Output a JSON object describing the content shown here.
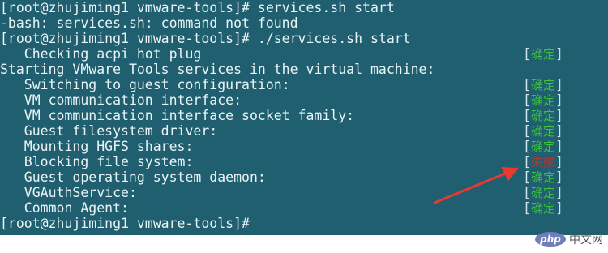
{
  "terminal": {
    "lines": [
      "[root@zhujiming1 vmware-tools]# services.sh start",
      "-bash: services.sh: command not found",
      "[root@zhujiming1 vmware-tools]# ./services.sh start",
      "   Checking acpi hot plug",
      "Starting VMware Tools services in the virtual machine:",
      "   Switching to guest configuration:",
      "   VM communication interface:",
      "   VM communication interface socket family:",
      "   Guest filesystem driver:",
      "   Mounting HGFS shares:",
      "   Blocking file system:",
      "   Guest operating system daemon:",
      "   VGAuthService:",
      "   Common Agent:",
      "[root@zhujiming1 vmware-tools]# "
    ],
    "statuses": {
      "acpi": "确定",
      "switching": "确定",
      "vmci": "确定",
      "vsock": "确定",
      "fs_driver": "确定",
      "hgfs": "确定",
      "blocking": "失败",
      "daemon": "确定",
      "vgauth": "确定",
      "agent": "确定"
    },
    "bracket_open": "[",
    "bracket_close": "]"
  },
  "watermark": {
    "logo": "php",
    "text": "中文网"
  },
  "colors": {
    "background": "#1f5f6f",
    "ok": "#3cc23c",
    "fail": "#c23030",
    "arrow": "#e83a30"
  }
}
